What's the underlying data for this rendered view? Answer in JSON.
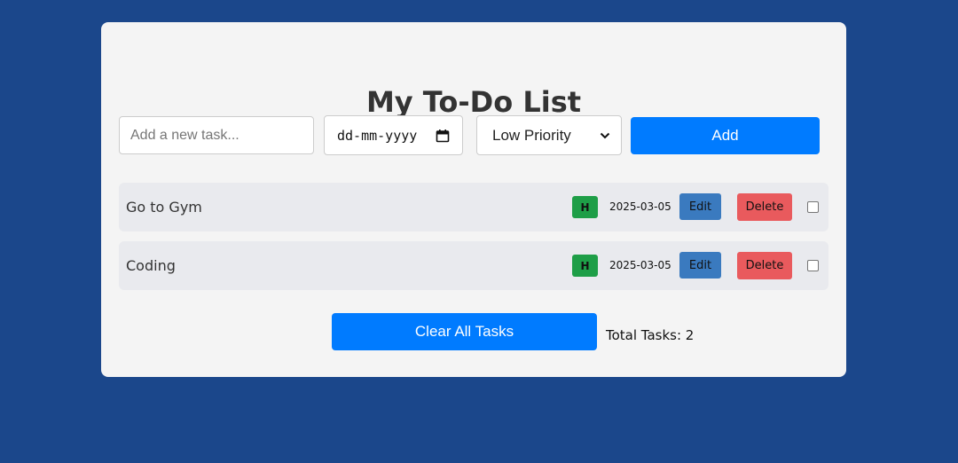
{
  "title": "My To-Do List",
  "new_task": {
    "placeholder": "Add a new task...",
    "value": ""
  },
  "date_field": {
    "value": "dd-mm-yyyy",
    "icon": "calendar-icon"
  },
  "priority_select": {
    "selected": "Low Priority",
    "icon": "chevron-down-icon"
  },
  "add_button": "Add",
  "tasks": [
    {
      "name": "Go to Gym",
      "priority": "H",
      "date": "2025-03-05",
      "edit": "Edit",
      "delete": "Delete",
      "done": false
    },
    {
      "name": "Coding",
      "priority": "H",
      "date": "2025-03-05",
      "edit": "Edit",
      "delete": "Delete",
      "done": false
    }
  ],
  "clear_button": "Clear All Tasks",
  "total_label": "Total Tasks: 2",
  "colors": {
    "background": "#1b478b",
    "card": "#f4f4f4",
    "primary": "#007bff",
    "edit": "#3a7abf",
    "delete": "#e95a5d",
    "priority_high": "#1e9e47",
    "row": "#e9eaee"
  }
}
